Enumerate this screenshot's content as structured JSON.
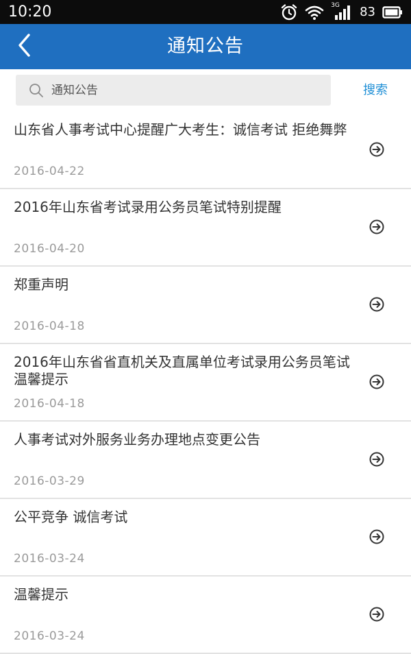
{
  "status_bar": {
    "time": "10:20",
    "network": "3G",
    "battery": "83"
  },
  "header": {
    "title": "通知公告",
    "back_icon": "chevron-left-icon"
  },
  "search": {
    "placeholder": "通知公告",
    "button_label": "搜索"
  },
  "notices": [
    {
      "title": "山东省人事考试中心提醒广大考生：诚信考试 拒绝舞弊",
      "date": "2016-04-22"
    },
    {
      "title": "2016年山东省考试录用公务员笔试特别提醒",
      "date": "2016-04-20"
    },
    {
      "title": "郑重声明",
      "date": "2016-04-18"
    },
    {
      "title": "2016年山东省省直机关及直属单位考试录用公务员笔试温馨提示",
      "date": "2016-04-18"
    },
    {
      "title": "人事考试对外服务业务办理地点变更公告",
      "date": "2016-03-29"
    },
    {
      "title": "公平竞争 诚信考试",
      "date": "2016-03-24"
    },
    {
      "title": "温馨提示",
      "date": "2016-03-24"
    }
  ],
  "colors": {
    "header_bg": "#1f6fc0",
    "accent": "#1f8fd6",
    "status_bar_bg": "#0c0c0c"
  }
}
